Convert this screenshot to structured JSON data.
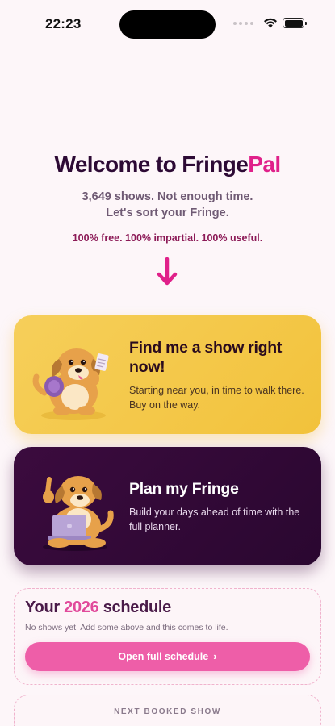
{
  "status_bar": {
    "time": "22:23"
  },
  "hero": {
    "title_main": "Welcome to Fringe",
    "title_accent": "Pal",
    "tagline_line1": "3,649 shows. Not enough time.",
    "tagline_line2": "Let's sort your Fringe.",
    "promise": "100% free. 100% impartial. 100% useful."
  },
  "icons": {
    "down_arrow": "arrow-down-icon",
    "wifi": "wifi-icon",
    "battery": "battery-icon",
    "chevron": "chevron-right-icon"
  },
  "cards": {
    "find": {
      "title": "Find me a show right now!",
      "description": "Starting near you, in time to walk there. Buy on the way."
    },
    "plan": {
      "title": "Plan my Fringe",
      "description": "Build your days ahead of time with the full planner."
    }
  },
  "schedule": {
    "title_prefix": "Your",
    "year": "2026",
    "title_suffix": "schedule",
    "subtitle": "No shows yet. Add some above and this comes to life.",
    "button_label": "Open full schedule",
    "button_chevron": "›"
  },
  "next_show": {
    "label": "NEXT BOOKED SHOW"
  },
  "colors": {
    "accent_pink": "#e0218a",
    "button_pink": "#ee5ea8",
    "card_yellow": "#f4c84a",
    "card_purple": "#340a38",
    "background": "#fdf6f9"
  }
}
